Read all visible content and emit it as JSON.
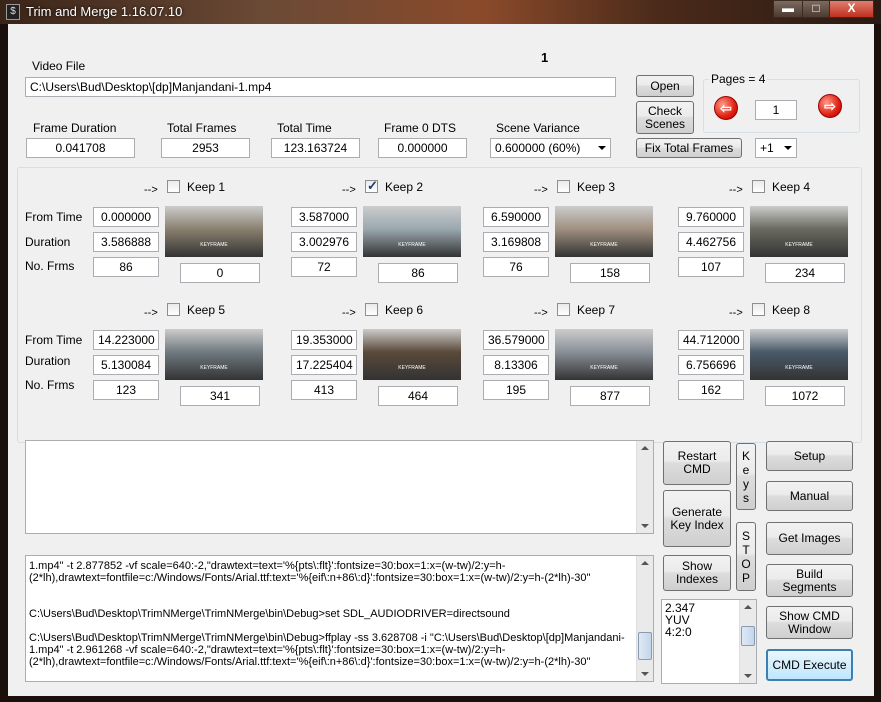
{
  "window": {
    "title": "Trim and Merge 1.16.07.10",
    "min_glyph": "▬",
    "max_glyph": "□",
    "close_glyph": "X"
  },
  "page_indicator": "1",
  "video_file": {
    "label": "Video File",
    "value": "C:\\Users\\Bud\\Desktop\\[dp]Manjandani-1.mp4"
  },
  "stats": {
    "frame_duration_label": "Frame Duration",
    "frame_duration": "0.041708",
    "total_frames_label": "Total Frames",
    "total_frames": "2953",
    "total_time_label": "Total Time",
    "total_time": "123.163724",
    "frame0_dts_label": "Frame 0 DTS",
    "frame0_dts": "0.000000",
    "scene_variance_label": "Scene Variance",
    "scene_variance": "0.600000   (60%)"
  },
  "buttons": {
    "open": "Open",
    "check_scenes": "Check Scenes",
    "fix_total_frames": "Fix Total Frames",
    "restart_cmd": "Restart CMD",
    "generate_key_index": "Generate Key Index",
    "show_indexes": "Show Indexes",
    "keys": "K e y s",
    "stop": "S T O P",
    "setup": "Setup",
    "manual": "Manual",
    "get_images": "Get Images",
    "build_segments": "Build Segments",
    "show_cmd_window": "Show CMD Window",
    "cmd_execute": "CMD Execute"
  },
  "pages": {
    "label": "Pages = 4",
    "current": "1",
    "prev_glyph": "⇦",
    "next_glyph": "⇨",
    "step": "+1"
  },
  "row_labels": {
    "from_time": "From Time",
    "duration": "Duration",
    "no_frms": "No. Frms"
  },
  "segment_arrow": "-->",
  "segments": [
    {
      "keep": "Keep 1",
      "checked": false,
      "from_time": "0.000000",
      "duration": "3.586888",
      "frames": "86",
      "start_frame": "0",
      "thumb_tone": "#8a8070"
    },
    {
      "keep": "Keep 2",
      "checked": true,
      "from_time": "3.587000",
      "duration": "3.002976",
      "frames": "72",
      "start_frame": "86",
      "thumb_tone": "#9aa8b0"
    },
    {
      "keep": "Keep 3",
      "checked": false,
      "from_time": "6.590000",
      "duration": "3.169808",
      "frames": "76",
      "start_frame": "158",
      "thumb_tone": "#a09080"
    },
    {
      "keep": "Keep 4",
      "checked": false,
      "from_time": "9.760000",
      "duration": "4.462756",
      "frames": "107",
      "start_frame": "234",
      "thumb_tone": "#6a6a60"
    },
    {
      "keep": "Keep 5",
      "checked": false,
      "from_time": "14.223000",
      "duration": "5.130084",
      "frames": "123",
      "start_frame": "341",
      "thumb_tone": "#707a80"
    },
    {
      "keep": "Keep 6",
      "checked": false,
      "from_time": "19.353000",
      "duration": "17.225404",
      "frames": "413",
      "start_frame": "464",
      "thumb_tone": "#5a4a3a"
    },
    {
      "keep": "Keep 7",
      "checked": false,
      "from_time": "36.579000",
      "duration": "8.13306",
      "frames": "195",
      "start_frame": "877",
      "thumb_tone": "#8a9098"
    },
    {
      "keep": "Keep 8",
      "checked": false,
      "from_time": "44.712000",
      "duration": "6.756696",
      "frames": "162",
      "start_frame": "1072",
      "thumb_tone": "#4a5a6a"
    }
  ],
  "thumb_caption": "KEYFRAME",
  "log_lines": [
    "1.mp4\" -t 2.877852 -vf scale=640:-2,\"drawtext=text='%{pts\\:flt}':fontsize=30:box=1:x=(w-tw)/2:y=h-",
    "(2*lh),drawtext=fontfile=c:/Windows/Fonts/Arial.ttf:text='%{eif\\:n+86\\:d}':fontsize=30:box=1:x=(w-tw)/2:y=h-(2*lh)-30\"",
    "",
    "",
    "C:\\Users\\Bud\\Desktop\\TrimNMerge\\TrimNMerge\\bin\\Debug>set SDL_AUDIODRIVER=directsound",
    "",
    "C:\\Users\\Bud\\Desktop\\TrimNMerge\\TrimNMerge\\bin\\Debug>ffplay -ss 3.628708 -i \"C:\\Users\\Bud\\Desktop\\[dp]Manjandani-",
    "1.mp4\" -t 2.961268 -vf scale=640:-2,\"drawtext=text='%{pts\\:flt}':fontsize=30:box=1:x=(w-tw)/2:y=h-",
    "(2*lh),drawtext=fontfile=c:/Windows/Fonts/Arial.ttf:text='%{eif\\:n+86\\:d}':fontsize=30:box=1:x=(w-tw)/2:y=h-(2*lh)-30\""
  ],
  "info_lines": [
    "2.347",
    "YUV",
    "4:2:0"
  ]
}
